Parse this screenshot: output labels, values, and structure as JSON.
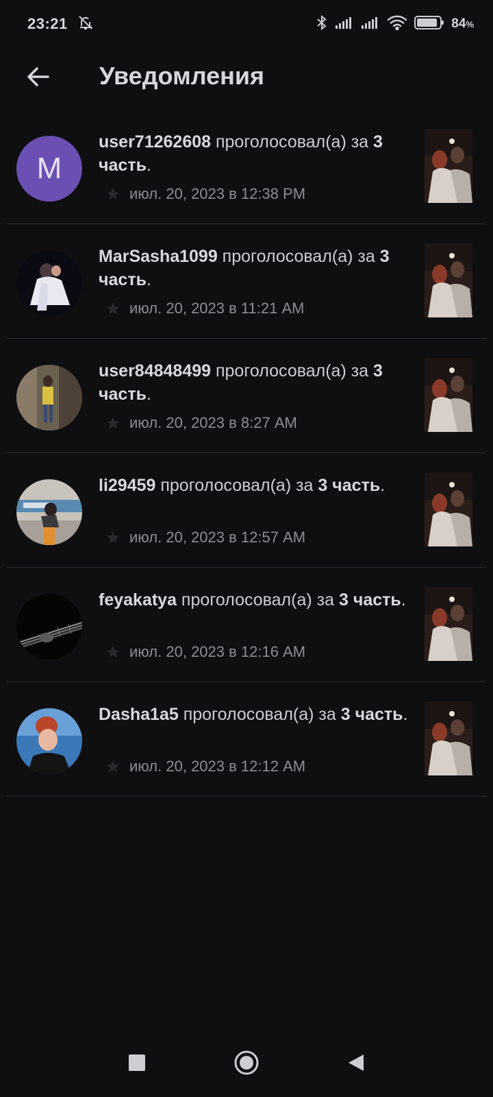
{
  "status_bar": {
    "time": "23:21",
    "battery_percent": "84",
    "battery_unit": "%",
    "battery_level": 0.84,
    "icons": [
      "bell-off-icon",
      "bluetooth-icon",
      "signal-icon",
      "signal-icon",
      "wifi-icon",
      "battery-icon"
    ]
  },
  "header": {
    "title": "Уведомления",
    "back_icon": "arrow-left-icon"
  },
  "notifications": [
    {
      "avatar_letter": "M",
      "username": "user71262608",
      "action": " проголосовал(а) за ",
      "part": "3 часть",
      "suffix": ".",
      "time": "июл. 20, 2023 в 12:38 PM"
    },
    {
      "avatar_letter": "",
      "username": "MarSasha1099",
      "action": " проголосовал(а) за ",
      "part": "3 часть",
      "suffix": ".",
      "time": "июл. 20, 2023 в 11:21 AM"
    },
    {
      "avatar_letter": "",
      "username": "user84848499",
      "action": " проголосовал(а) за ",
      "part": "3 часть",
      "suffix": ".",
      "time": "июл. 20, 2023 в 8:27 AM"
    },
    {
      "avatar_letter": "",
      "username": "li29459",
      "action": " проголосовал(а) за ",
      "part": "3 часть",
      "suffix": ".",
      "time": "июл. 20, 2023 в 12:57 AM"
    },
    {
      "avatar_letter": "",
      "username": "feyakatya",
      "action": " проголосовал(а) за ",
      "part": "3 часть",
      "suffix": ".",
      "time": "июл. 20, 2023 в 12:16 AM"
    },
    {
      "avatar_letter": "",
      "username": "Dasha1a5",
      "action": " проголосовал(а) за ",
      "part": "3 часть",
      "suffix": ".",
      "time": "июл. 20, 2023 в 12:12 AM"
    }
  ],
  "colors": {
    "background": "#0f0e11",
    "avatar_letter_bg": "#6c4fb3",
    "divider": "#2b2a2e"
  },
  "nav_bar": {
    "icons": [
      "recents-square-icon",
      "home-circle-icon",
      "back-triangle-icon"
    ]
  }
}
